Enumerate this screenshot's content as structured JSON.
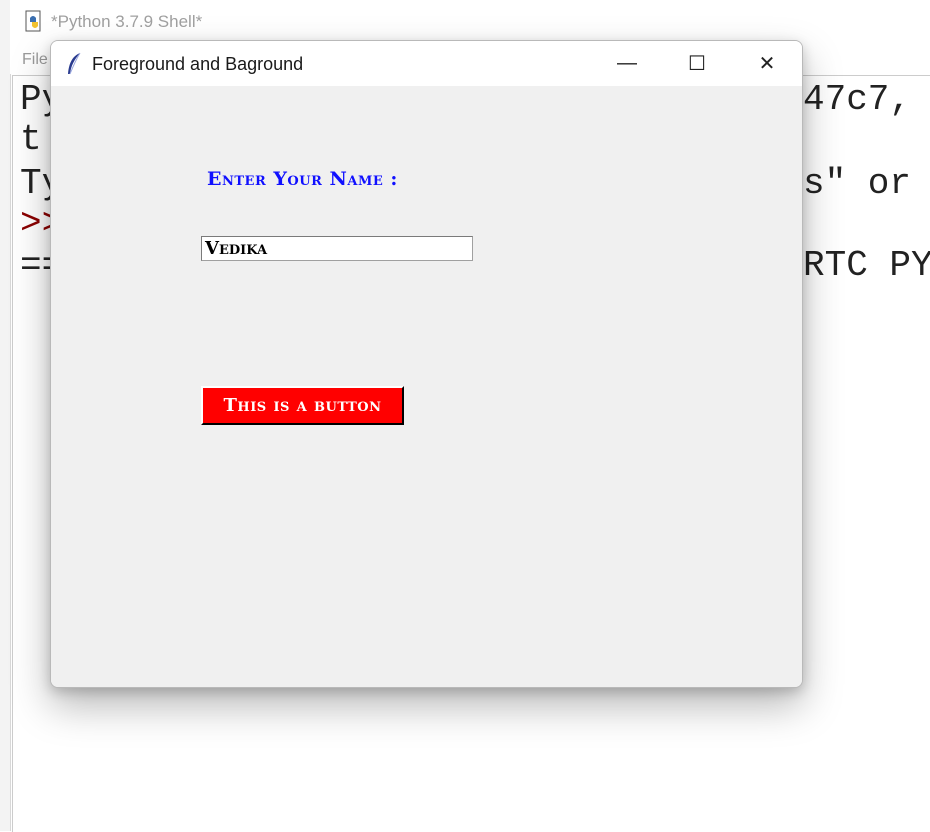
{
  "shell": {
    "title": "*Python 3.7.9 Shell*",
    "menu_file": "File",
    "lines": {
      "line1_left": "Py",
      "line1_right": "47c7, ",
      "line2_left": "t",
      "line3_left": "Ty",
      "line3_right": "s\" or",
      "line4_prompt": ">>",
      "line5_left": "==",
      "line5_right": "RTC PY"
    }
  },
  "tk_window": {
    "title": "Foreground and Baground",
    "controls": {
      "minimize_glyph": "—",
      "maximize_glyph": "☐",
      "close_glyph": "✕"
    },
    "label_text": "Enter Your Name :",
    "entry_value": "Vedika",
    "button_label": "This is a button",
    "colors": {
      "label_fg": "#1010ff",
      "button_bg": "#ff0000",
      "button_fg": "#ffffff",
      "window_bg": "#f0f0f0"
    }
  }
}
